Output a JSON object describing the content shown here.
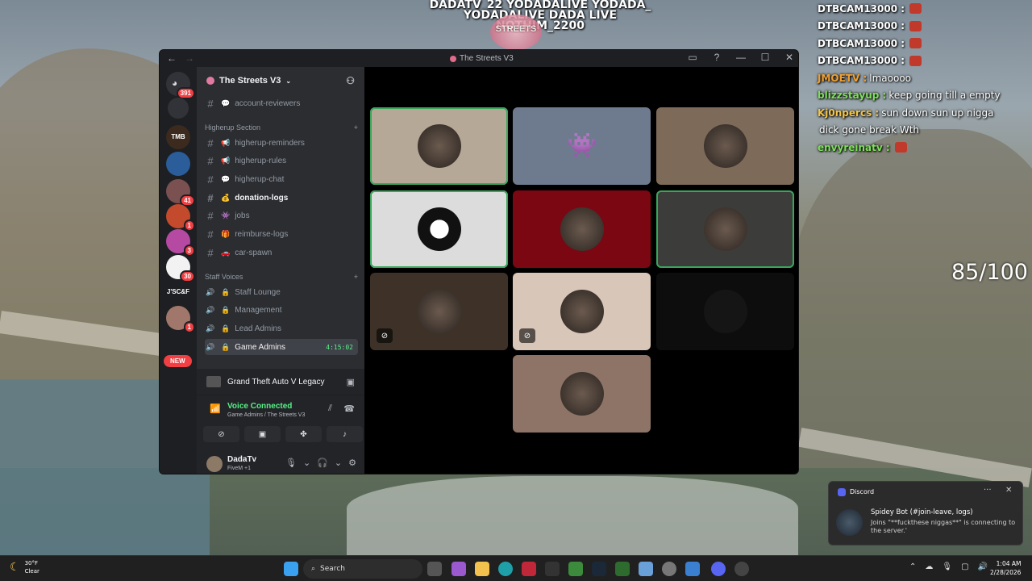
{
  "overlay": {
    "social_line1": "DADATV_22 YODADALIVE YODADA_",
    "social_line2": "YODADALIVE DADA LIVE NOTHIM_2200",
    "sticker_text": "STREETS",
    "counter": "85/100"
  },
  "chat": [
    {
      "user": "DTBCAM13000 :",
      "text": "",
      "color": "#ffffff"
    },
    {
      "user": "DTBCAM13000 :",
      "text": "",
      "color": "#ffffff"
    },
    {
      "user": "DTBCAM13000 :",
      "text": "",
      "color": "#ffffff"
    },
    {
      "user": "DTBCAM13000 :",
      "text": "",
      "color": "#ffffff"
    },
    {
      "user": "JMOETV :",
      "text": "lmaoooo",
      "color": "#f0a030"
    },
    {
      "user": "blizzstayup :",
      "text": "keep going till a empty",
      "color": "#7ee05a"
    },
    {
      "user": "Kj0npercs :",
      "text": "sun down sun up nigga",
      "color": "#f5c542"
    },
    {
      "user": "",
      "text": "dick gone break Wth",
      "color": "#ffffff"
    },
    {
      "user": "envyreinatv :",
      "text": "",
      "color": "#7ee05a"
    }
  ],
  "window": {
    "title": "The Streets V3"
  },
  "servers": {
    "home_badge": "391",
    "items": [
      {
        "label": "TMB",
        "badge": ""
      },
      {
        "label": "",
        "badge": ""
      },
      {
        "label": "",
        "badge": "41"
      },
      {
        "label": "",
        "badge": "1"
      },
      {
        "label": "",
        "badge": "3"
      },
      {
        "label": "",
        "badge": "30"
      },
      {
        "label": "J'SC&F",
        "badge": ""
      },
      {
        "label": "",
        "badge": "1"
      }
    ],
    "new_label": "NEW"
  },
  "sidebar": {
    "server_name": "The Streets V3",
    "channels_top": [
      {
        "name": "account-reviewers",
        "emoji": "💬"
      }
    ],
    "category_higherup": "Higherup Section",
    "channels_higherup": [
      {
        "name": "higherup-reminders",
        "emoji": "📢"
      },
      {
        "name": "higherup-rules",
        "emoji": "📢"
      },
      {
        "name": "higherup-chat",
        "emoji": "💬"
      },
      {
        "name": "donation-logs",
        "emoji": "💰"
      },
      {
        "name": "jobs",
        "emoji": "👾"
      },
      {
        "name": "reimburse-logs",
        "emoji": "🎁"
      },
      {
        "name": "car-spawn",
        "emoji": "🚗"
      }
    ],
    "category_staff": "Staff Voices",
    "voice_channels": [
      {
        "name": "Staff Lounge"
      },
      {
        "name": "Management"
      },
      {
        "name": "Lead Admins"
      },
      {
        "name": "Game Admins"
      }
    ],
    "active_time": "4:15:02",
    "game_activity": "Grand Theft Auto V Legacy",
    "voice_status": "Voice Connected",
    "voice_sub": "Game Admins / The Streets V3",
    "username": "DadaTv",
    "user_status": "FiveM +1"
  },
  "tiles_colors": [
    "#b6a897",
    "#6e7b8f",
    "#7d6a58",
    "#dcdcdc",
    "#7a0712",
    "#3c3d3a",
    "#3e3228",
    "#d8c6b8",
    "#0d0d0d",
    "#8e7466"
  ],
  "notification": {
    "app": "Discord",
    "title": "Spidey Bot (#join-leave, logs)",
    "body": "Joins \"**fuckthese niggas**\" is connecting to the server.'"
  },
  "taskbar": {
    "temp": "30°F",
    "condition": "Clear",
    "search_placeholder": "Search",
    "time": "1:04 AM",
    "date": "2/28/2026"
  }
}
